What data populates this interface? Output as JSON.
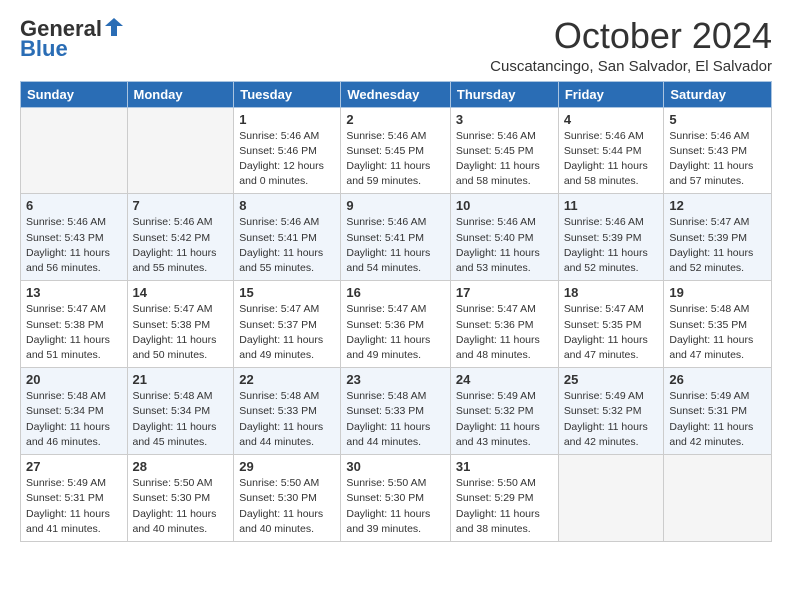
{
  "header": {
    "logo_general": "General",
    "logo_blue": "Blue",
    "month_title": "October 2024",
    "subtitle": "Cuscatancingo, San Salvador, El Salvador"
  },
  "days_of_week": [
    "Sunday",
    "Monday",
    "Tuesday",
    "Wednesday",
    "Thursday",
    "Friday",
    "Saturday"
  ],
  "weeks": [
    [
      {
        "day": "",
        "info": ""
      },
      {
        "day": "",
        "info": ""
      },
      {
        "day": "1",
        "info": "Sunrise: 5:46 AM\nSunset: 5:46 PM\nDaylight: 12 hours\nand 0 minutes."
      },
      {
        "day": "2",
        "info": "Sunrise: 5:46 AM\nSunset: 5:45 PM\nDaylight: 11 hours\nand 59 minutes."
      },
      {
        "day": "3",
        "info": "Sunrise: 5:46 AM\nSunset: 5:45 PM\nDaylight: 11 hours\nand 58 minutes."
      },
      {
        "day": "4",
        "info": "Sunrise: 5:46 AM\nSunset: 5:44 PM\nDaylight: 11 hours\nand 58 minutes."
      },
      {
        "day": "5",
        "info": "Sunrise: 5:46 AM\nSunset: 5:43 PM\nDaylight: 11 hours\nand 57 minutes."
      }
    ],
    [
      {
        "day": "6",
        "info": "Sunrise: 5:46 AM\nSunset: 5:43 PM\nDaylight: 11 hours\nand 56 minutes."
      },
      {
        "day": "7",
        "info": "Sunrise: 5:46 AM\nSunset: 5:42 PM\nDaylight: 11 hours\nand 55 minutes."
      },
      {
        "day": "8",
        "info": "Sunrise: 5:46 AM\nSunset: 5:41 PM\nDaylight: 11 hours\nand 55 minutes."
      },
      {
        "day": "9",
        "info": "Sunrise: 5:46 AM\nSunset: 5:41 PM\nDaylight: 11 hours\nand 54 minutes."
      },
      {
        "day": "10",
        "info": "Sunrise: 5:46 AM\nSunset: 5:40 PM\nDaylight: 11 hours\nand 53 minutes."
      },
      {
        "day": "11",
        "info": "Sunrise: 5:46 AM\nSunset: 5:39 PM\nDaylight: 11 hours\nand 52 minutes."
      },
      {
        "day": "12",
        "info": "Sunrise: 5:47 AM\nSunset: 5:39 PM\nDaylight: 11 hours\nand 52 minutes."
      }
    ],
    [
      {
        "day": "13",
        "info": "Sunrise: 5:47 AM\nSunset: 5:38 PM\nDaylight: 11 hours\nand 51 minutes."
      },
      {
        "day": "14",
        "info": "Sunrise: 5:47 AM\nSunset: 5:38 PM\nDaylight: 11 hours\nand 50 minutes."
      },
      {
        "day": "15",
        "info": "Sunrise: 5:47 AM\nSunset: 5:37 PM\nDaylight: 11 hours\nand 49 minutes."
      },
      {
        "day": "16",
        "info": "Sunrise: 5:47 AM\nSunset: 5:36 PM\nDaylight: 11 hours\nand 49 minutes."
      },
      {
        "day": "17",
        "info": "Sunrise: 5:47 AM\nSunset: 5:36 PM\nDaylight: 11 hours\nand 48 minutes."
      },
      {
        "day": "18",
        "info": "Sunrise: 5:47 AM\nSunset: 5:35 PM\nDaylight: 11 hours\nand 47 minutes."
      },
      {
        "day": "19",
        "info": "Sunrise: 5:48 AM\nSunset: 5:35 PM\nDaylight: 11 hours\nand 47 minutes."
      }
    ],
    [
      {
        "day": "20",
        "info": "Sunrise: 5:48 AM\nSunset: 5:34 PM\nDaylight: 11 hours\nand 46 minutes."
      },
      {
        "day": "21",
        "info": "Sunrise: 5:48 AM\nSunset: 5:34 PM\nDaylight: 11 hours\nand 45 minutes."
      },
      {
        "day": "22",
        "info": "Sunrise: 5:48 AM\nSunset: 5:33 PM\nDaylight: 11 hours\nand 44 minutes."
      },
      {
        "day": "23",
        "info": "Sunrise: 5:48 AM\nSunset: 5:33 PM\nDaylight: 11 hours\nand 44 minutes."
      },
      {
        "day": "24",
        "info": "Sunrise: 5:49 AM\nSunset: 5:32 PM\nDaylight: 11 hours\nand 43 minutes."
      },
      {
        "day": "25",
        "info": "Sunrise: 5:49 AM\nSunset: 5:32 PM\nDaylight: 11 hours\nand 42 minutes."
      },
      {
        "day": "26",
        "info": "Sunrise: 5:49 AM\nSunset: 5:31 PM\nDaylight: 11 hours\nand 42 minutes."
      }
    ],
    [
      {
        "day": "27",
        "info": "Sunrise: 5:49 AM\nSunset: 5:31 PM\nDaylight: 11 hours\nand 41 minutes."
      },
      {
        "day": "28",
        "info": "Sunrise: 5:50 AM\nSunset: 5:30 PM\nDaylight: 11 hours\nand 40 minutes."
      },
      {
        "day": "29",
        "info": "Sunrise: 5:50 AM\nSunset: 5:30 PM\nDaylight: 11 hours\nand 40 minutes."
      },
      {
        "day": "30",
        "info": "Sunrise: 5:50 AM\nSunset: 5:30 PM\nDaylight: 11 hours\nand 39 minutes."
      },
      {
        "day": "31",
        "info": "Sunrise: 5:50 AM\nSunset: 5:29 PM\nDaylight: 11 hours\nand 38 minutes."
      },
      {
        "day": "",
        "info": ""
      },
      {
        "day": "",
        "info": ""
      }
    ]
  ]
}
